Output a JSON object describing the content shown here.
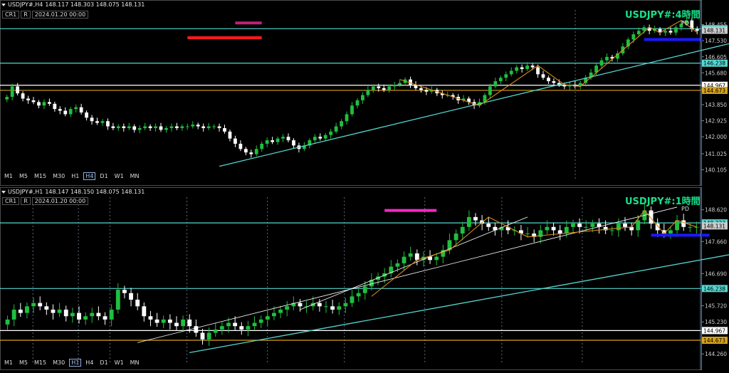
{
  "colors": {
    "up": "#1fbf3f",
    "down": "#ffffff",
    "zigzag": "#d98c1a",
    "cyan": "#53d7d0",
    "white_line": "#ffffff",
    "orange_line": "#d9a21a",
    "red": "#ff1a1a",
    "magenta_top": "#c0207a",
    "magenta_bottom": "#ff24c8",
    "blue": "#1a1aff",
    "title": "#18e08a",
    "grid": "#5a6a7a"
  },
  "toolbar_timeframes": [
    "M1",
    "M5",
    "M15",
    "M30",
    "H1",
    "H4",
    "D1",
    "W1",
    "MN"
  ],
  "crosshair_time": "2024.01.20 00:00",
  "cr_label": "CR1",
  "r_label": "R",
  "chart_data": [
    {
      "type": "candlestick",
      "symbol": "USDJPY#,H4",
      "ohlc_text": "148.117 148.303 148.075 148.131",
      "title": "USDJPY#:4時間",
      "subtitle": "PD",
      "active_tf": "H4",
      "ylim": [
        140.0,
        149.3
      ],
      "y_ticks": [
        148.455,
        147.53,
        146.605,
        145.68,
        144.755,
        143.85,
        142.925,
        142.0,
        141.025,
        140.105
      ],
      "price_labels": [
        {
          "value": 148.223,
          "text": "148.223",
          "color": "#53d7d0"
        },
        {
          "value": 146.238,
          "text": "146.238",
          "color": "#53d7d0"
        },
        {
          "value": 144.967,
          "text": "144.967",
          "color": "#ffffff"
        },
        {
          "value": 144.673,
          "text": "144.673",
          "color": "#d9a21a"
        },
        {
          "value": 148.131,
          "text": "148.131",
          "color": "#cccccc"
        }
      ],
      "hlines": [
        {
          "value": 148.223,
          "color": "#53d7d0"
        },
        {
          "value": 146.238,
          "color": "#53d7d0"
        },
        {
          "value": 144.967,
          "color": "#ffffff"
        },
        {
          "value": 144.673,
          "color": "#d9a21a"
        }
      ],
      "closes": [
        144.3,
        144.9,
        144.5,
        144.2,
        144.1,
        144.0,
        143.8,
        144.0,
        143.9,
        143.6,
        143.5,
        143.3,
        143.6,
        143.7,
        143.4,
        143.1,
        142.9,
        142.8,
        142.9,
        142.6,
        142.5,
        142.6,
        142.5,
        142.6,
        142.4,
        142.5,
        142.6,
        142.5,
        142.6,
        142.4,
        142.5,
        142.6,
        142.5,
        142.6,
        142.6,
        142.7,
        142.6,
        142.5,
        142.6,
        142.6,
        142.5,
        142.3,
        141.9,
        141.6,
        141.3,
        141.1,
        141.0,
        141.3,
        141.6,
        141.8,
        141.7,
        141.9,
        142.0,
        141.8,
        141.5,
        141.3,
        141.5,
        141.8,
        142.0,
        141.9,
        142.1,
        142.3,
        142.6,
        142.9,
        143.3,
        143.8,
        144.1,
        144.4,
        144.7,
        144.9,
        144.8,
        144.7,
        144.9,
        145.0,
        145.1,
        145.3,
        145.0,
        144.8,
        144.7,
        144.6,
        144.7,
        144.5,
        144.4,
        144.4,
        144.3,
        144.1,
        144.2,
        144.0,
        143.8,
        144.0,
        144.4,
        144.9,
        145.2,
        145.4,
        145.6,
        145.8,
        146.0,
        145.9,
        146.1,
        146.0,
        145.6,
        145.4,
        145.2,
        145.1,
        145.0,
        144.9,
        145.0,
        144.9,
        145.1,
        145.4,
        145.7,
        146.1,
        146.4,
        146.6,
        146.5,
        146.8,
        147.2,
        147.6,
        147.9,
        148.1,
        148.3,
        148.1,
        148.2,
        148.0,
        148.1,
        148.0,
        148.3,
        148.5,
        148.7,
        148.2,
        148.1
      ],
      "zigzag": [
        [
          74,
          145.3
        ],
        [
          89,
          143.8
        ],
        [
          100,
          146.1
        ],
        [
          105,
          145.0
        ],
        [
          108,
          144.9
        ],
        [
          121,
          148.3
        ],
        [
          123,
          148.0
        ],
        [
          127,
          148.7
        ],
        [
          130,
          148.0
        ]
      ],
      "trendlines": [
        {
          "from": [
            40,
            140.3
          ],
          "to": [
            142,
            147.8
          ],
          "color": "#53d7d0"
        }
      ],
      "segments": [
        {
          "from": [
            34,
            147.7
          ],
          "to": [
            48,
            147.7
          ],
          "color": "#ff1a1a"
        },
        {
          "from": [
            43,
            148.55
          ],
          "to": [
            48,
            148.55
          ],
          "color": "#c0207a"
        },
        {
          "from": [
            120,
            147.6
          ],
          "to": [
            131,
            147.6
          ],
          "color": "#1a1aff"
        }
      ]
    },
    {
      "type": "candlestick",
      "symbol": "USDJPY#,H1",
      "ohlc_text": "148.147 148.150 148.075 148.131",
      "title": "USDJPY#:1時間",
      "subtitle": "PD",
      "active_tf": "H1",
      "ylim": [
        144.2,
        149.0
      ],
      "y_ticks": [
        148.62,
        147.66,
        146.69,
        145.72,
        145.23,
        144.26
      ],
      "price_labels": [
        {
          "value": 148.223,
          "text": "148.223",
          "color": "#53d7d0"
        },
        {
          "value": 146.238,
          "text": "146.238",
          "color": "#53d7d0"
        },
        {
          "value": 144.967,
          "text": "144.967",
          "color": "#ffffff"
        },
        {
          "value": 144.673,
          "text": "144.673",
          "color": "#d9a21a"
        },
        {
          "value": 148.131,
          "text": "148.131",
          "color": "#cccccc"
        }
      ],
      "hlines": [
        {
          "value": 148.223,
          "color": "#53d7d0"
        },
        {
          "value": 146.238,
          "color": "#53d7d0"
        },
        {
          "value": 144.967,
          "color": "#ffffff"
        },
        {
          "value": 144.673,
          "color": "#d9a21a"
        }
      ],
      "closes": [
        145.3,
        145.6,
        145.5,
        145.7,
        145.8,
        145.7,
        145.6,
        145.5,
        145.6,
        145.4,
        145.5,
        145.3,
        145.4,
        145.5,
        145.4,
        145.3,
        145.6,
        146.2,
        146.1,
        145.9,
        145.7,
        145.4,
        145.3,
        145.2,
        145.3,
        145.2,
        145.1,
        145.3,
        145.1,
        144.9,
        144.7,
        144.9,
        145.0,
        145.1,
        145.2,
        145.1,
        145.0,
        145.1,
        145.2,
        145.3,
        145.4,
        145.5,
        145.6,
        145.7,
        145.8,
        145.7,
        145.7,
        145.8,
        145.7,
        145.7,
        145.6,
        145.7,
        145.8,
        146.0,
        146.1,
        146.3,
        146.5,
        146.6,
        146.7,
        146.9,
        147.0,
        147.2,
        147.3,
        147.1,
        147.2,
        147.1,
        147.2,
        147.4,
        147.7,
        147.9,
        148.1,
        148.4,
        148.3,
        148.2,
        148.1,
        148.0,
        148.1,
        148.0,
        148.0,
        147.9,
        147.9,
        147.8,
        148.0,
        148.1,
        148.0,
        147.9,
        148.1,
        148.2,
        148.1,
        148.1,
        148.2,
        148.1,
        148.0,
        148.0,
        148.2,
        148.1,
        148.0,
        148.3,
        148.6,
        148.2,
        148.0,
        147.9,
        148.0,
        148.3,
        148.1,
        148.1,
        148.1
      ],
      "zigzag": [
        [
          56,
          146.0
        ],
        [
          63,
          147.1
        ],
        [
          68,
          147.4
        ],
        [
          74,
          148.4
        ],
        [
          80,
          147.8
        ],
        [
          96,
          148.1
        ],
        [
          98,
          148.6
        ],
        [
          101,
          147.9
        ],
        [
          103,
          148.3
        ],
        [
          106,
          148.1
        ]
      ],
      "trendlines": [
        {
          "from": [
            28,
            144.3
          ],
          "to": [
            143,
            148.4
          ],
          "color": "#53d7d0"
        },
        {
          "from": [
            20,
            144.6
          ],
          "to": [
            103,
            148.7
          ],
          "color": "#ffffff"
        },
        {
          "from": [
            45,
            145.6
          ],
          "to": [
            80,
            148.4
          ],
          "color": "#ffffff"
        }
      ],
      "segments": [
        {
          "from": [
            58,
            148.6
          ],
          "to": [
            66,
            148.6
          ],
          "color": "#ff24c8"
        },
        {
          "from": [
            99,
            147.85
          ],
          "to": [
            108,
            147.85
          ],
          "color": "#1a1aff"
        }
      ]
    }
  ]
}
